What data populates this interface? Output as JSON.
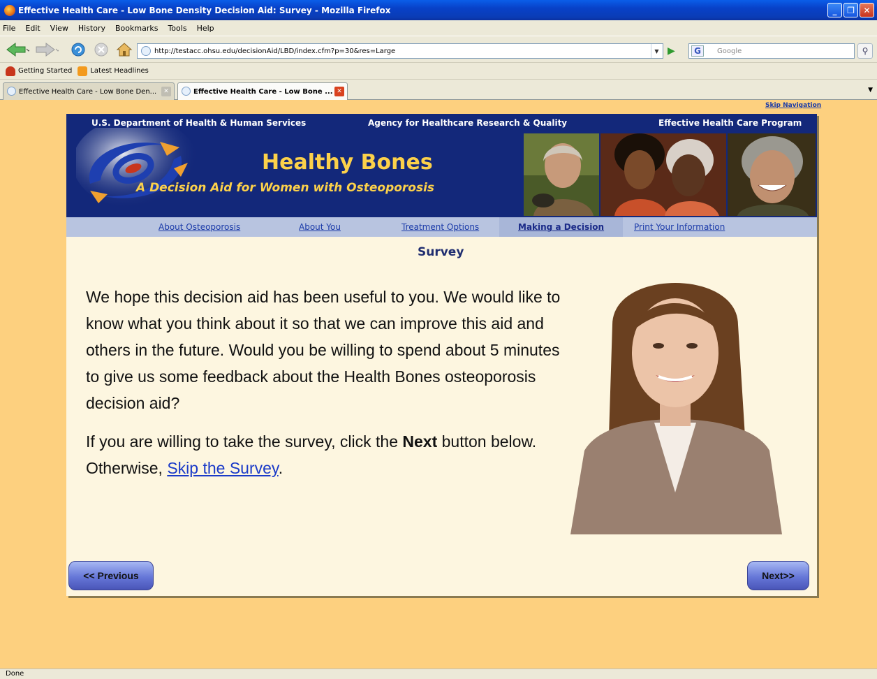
{
  "window": {
    "title": "Effective Health Care - Low Bone Density Decision Aid: Survey - Mozilla Firefox"
  },
  "menu": {
    "items": [
      "File",
      "Edit",
      "View",
      "History",
      "Bookmarks",
      "Tools",
      "Help"
    ]
  },
  "toolbar": {
    "url": "http://testacc.ohsu.edu/decisionAid/LBD/index.cfm?p=30&res=Large",
    "search_placeholder": "Google"
  },
  "bookmarks": {
    "items": [
      "Getting Started",
      "Latest Headlines"
    ]
  },
  "tabs": [
    {
      "label": "Effective Health Care - Low Bone Den...",
      "active": false
    },
    {
      "label": "Effective Health Care - Low Bone ...",
      "active": true
    }
  ],
  "page": {
    "skip_nav": "Skip Navigation",
    "header": {
      "dept": "U.S. Department of Health & Human Services",
      "agency": "Agency for Healthcare Research & Quality",
      "program": "Effective Health Care Program",
      "title": "Healthy Bones",
      "subtitle": "A Decision Aid for Women with Osteoporosis"
    },
    "nav": [
      {
        "label": "About Osteoporosis"
      },
      {
        "label": "About You"
      },
      {
        "label": "Treatment Options"
      },
      {
        "label": "Making a Decision",
        "active": true
      },
      {
        "label": "Print Your Information"
      }
    ],
    "section_title": "Survey",
    "paragraph1": "We hope this decision aid has been useful to you. We would like to know what you think about it so that we can improve this aid and others in the future. Would you be willing to spend about 5 minutes to give us some feedback about the Health Bones osteoporosis decision aid?",
    "paragraph2_pre": "If you are willing to take the survey, click the ",
    "paragraph2_bold": "Next",
    "paragraph2_mid": " button below. Otherwise, ",
    "skip_link": "Skip the Survey",
    "paragraph2_end": ".",
    "prev_button": "<< Previous",
    "next_button": "Next>>"
  },
  "status": {
    "text": "Done"
  },
  "colors": {
    "header_bg": "#13287a",
    "brand_yellow": "#fcd14a",
    "page_bg": "#fdd07f",
    "content_bg": "#fdf6e0",
    "nav_bg": "#b8c4e0"
  }
}
